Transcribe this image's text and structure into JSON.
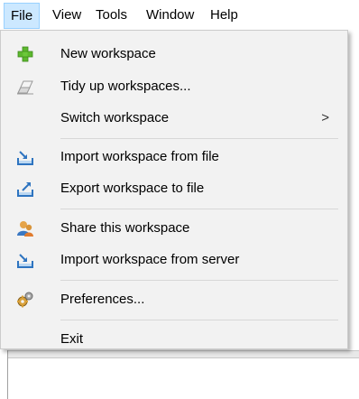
{
  "menubar": {
    "items": [
      {
        "label": "File"
      },
      {
        "label": "View"
      },
      {
        "label": "Tools"
      },
      {
        "label": "Window"
      },
      {
        "label": "Help"
      }
    ],
    "active": "File"
  },
  "file_menu": {
    "items": [
      {
        "label": "New workspace",
        "icon": "green-plus-icon"
      },
      {
        "label": "Tidy up workspaces...",
        "icon": "eraser-icon"
      },
      {
        "label": "Switch workspace",
        "submenu_arrow": ">"
      },
      {
        "label": "Import workspace from file",
        "icon": "import-tray-icon"
      },
      {
        "label": "Export workspace to file",
        "icon": "export-tray-icon"
      },
      {
        "label": "Share this workspace",
        "icon": "users-share-icon"
      },
      {
        "label": "Import workspace from server",
        "icon": "import-tray-icon"
      },
      {
        "label": "Preferences...",
        "icon": "gears-icon"
      },
      {
        "label": "Exit"
      }
    ]
  },
  "colors": {
    "menu_background": "#f2f2f2",
    "active_menu_highlight": "#cce8ff",
    "active_menu_border": "#99d1ff",
    "plus_green": "#5cb82e",
    "tray_blue": "#2e74c0"
  }
}
